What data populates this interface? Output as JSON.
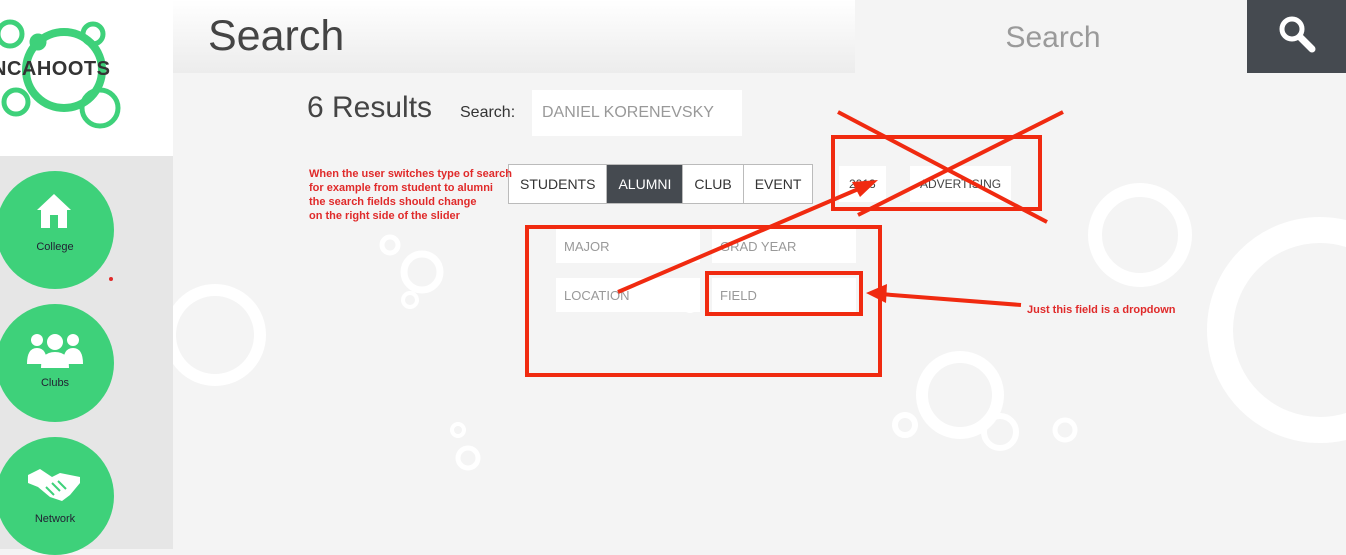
{
  "app": {
    "logo_text": "NCAHOOTS"
  },
  "sidebar": {
    "items": [
      {
        "label": "College",
        "icon": "home-icon"
      },
      {
        "label": "Clubs",
        "icon": "people-icon"
      },
      {
        "label": "Network",
        "icon": "handshake-icon"
      }
    ]
  },
  "header": {
    "title": "Search",
    "search_placeholder": "Search"
  },
  "results": {
    "count_text": "6 Results",
    "search_label": "Search:",
    "query": "DANIEL KORENEVSKY"
  },
  "tabs": [
    {
      "label": "STUDENTS",
      "active": false
    },
    {
      "label": "ALUMNI",
      "active": true
    },
    {
      "label": "CLUB",
      "active": false
    },
    {
      "label": "EVENT",
      "active": false
    }
  ],
  "extra_filters": {
    "year": "2013",
    "category": "ADVERTISING"
  },
  "fields": {
    "major": "MAJOR",
    "grad_year": "GRAD YEAR",
    "location": "LOCATION",
    "field": "FIELD"
  },
  "annotations": {
    "note_left": [
      "When the user switches type of search",
      "for example from student to alumni",
      "the search fields should change",
      "on the right side of the slider"
    ],
    "note_right": "Just this field is a dropdown"
  },
  "colors": {
    "accent_green": "#3ed17a",
    "dark": "#454a50",
    "annotation_red": "#e02a2a"
  }
}
